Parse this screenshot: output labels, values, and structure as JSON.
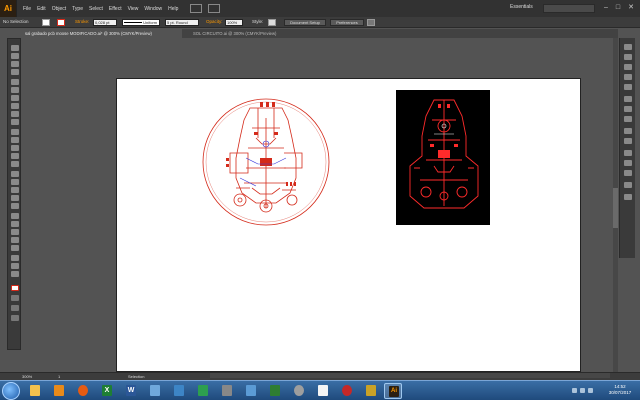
{
  "app": {
    "logo": "Ai",
    "menu": [
      "File",
      "Edit",
      "Object",
      "Type",
      "Select",
      "Effect",
      "View",
      "Window",
      "Help"
    ],
    "workspace": "Essentials",
    "search_placeholder": "",
    "window_buttons": [
      "–",
      "□",
      "✕"
    ]
  },
  "control_bar": {
    "selection": "No Selection",
    "stroke_label": "Stroke:",
    "stroke_weight": "0,028 pt",
    "profile": "Uniform",
    "brush": "5 pt. Round",
    "opacity_label": "Opacity:",
    "opacity_value": "100%",
    "style_label": "Style:",
    "document_setup": "Document Setup",
    "preferences": "Preferences"
  },
  "tabs": [
    {
      "label": "sal grabado pcb moose MODIFICADO.ai* @ 300% (CMYK/Preview)",
      "active": true
    },
    {
      "label": "SOL CIRCUITO.ai @ 300% (CMYK/Preview)",
      "active": false
    }
  ],
  "status_bar": {
    "zoom": "300%",
    "page": "1",
    "tool": "Selection"
  },
  "taskbar": {
    "items": [
      "file-explorer",
      "media-player",
      "firefox",
      "excel",
      "word",
      "remote-desktop",
      "network",
      "media-center",
      "printer",
      "pictures",
      "recycle",
      "gear",
      "notes",
      "alert",
      "app",
      "illustrator"
    ],
    "time": "14:52",
    "date": "30/07/2017"
  },
  "colors": {
    "accent": "#ff9a00",
    "trace": "#d42a1a",
    "trace_bright": "#ff2b2b",
    "artboard": "#ffffff",
    "canvas": "#535353"
  }
}
